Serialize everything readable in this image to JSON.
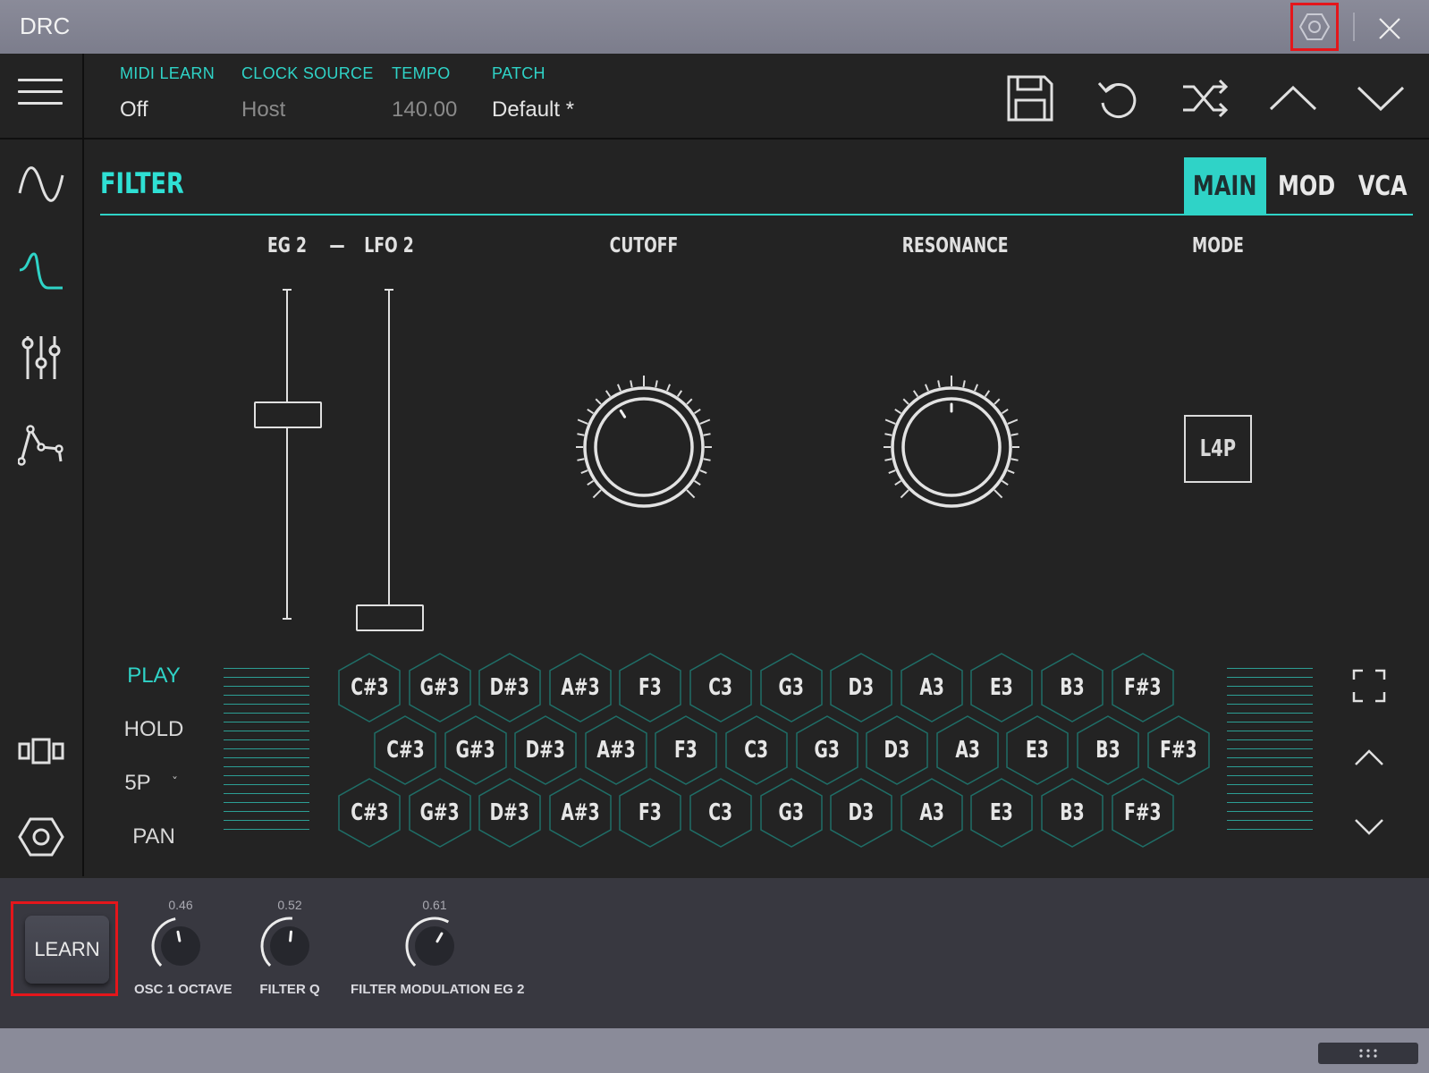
{
  "window": {
    "title": "DRC"
  },
  "header": {
    "midi_learn": {
      "label": "MIDI LEARN",
      "value": "Off"
    },
    "clock_source": {
      "label": "CLOCK SOURCE",
      "value": "Host"
    },
    "tempo": {
      "label": "TEMPO",
      "value": "140.00"
    },
    "patch": {
      "label": "PATCH",
      "value": "Default *"
    }
  },
  "filter": {
    "title": "FILTER",
    "tabs": [
      {
        "label": "MAIN",
        "active": true
      },
      {
        "label": "MOD",
        "active": false
      },
      {
        "label": "VCA",
        "active": false
      }
    ],
    "eg2_label": "EG 2",
    "dash": "—",
    "lfo2_label": "LFO 2",
    "eg2_level": 0.62,
    "lfo2_level": 0.0,
    "cutoff_label": "CUTOFF",
    "cutoff_level": 0.38,
    "resonance_label": "RESONANCE",
    "resonance_level": 0.5,
    "mode_label": "MODE",
    "mode_value": "L4P"
  },
  "keyboard": {
    "modes": [
      "PLAY",
      "HOLD",
      "5P",
      "PAN"
    ],
    "active_mode": "PLAY",
    "dropdown_glyph": "ˇ",
    "rows": [
      [
        "C#3",
        "G#3",
        "D#3",
        "A#3",
        "F3",
        "C3",
        "G3",
        "D3",
        "A3",
        "E3",
        "B3",
        "F#3"
      ],
      [
        "C#3",
        "G#3",
        "D#3",
        "A#3",
        "F3",
        "C3",
        "G3",
        "D3",
        "A3",
        "E3",
        "B3",
        "F#3"
      ],
      [
        "C#3",
        "G#3",
        "D#3",
        "A#3",
        "F3",
        "C3",
        "G3",
        "D3",
        "A3",
        "E3",
        "B3",
        "F#3"
      ]
    ]
  },
  "learn_bar": {
    "learn_label": "LEARN",
    "assignments": [
      {
        "name": "OSC 1 OCTAVE",
        "value": "0.46"
      },
      {
        "name": "FILTER Q",
        "value": "0.52"
      },
      {
        "name": "FILTER MODULATION EG 2",
        "value": "0.61"
      }
    ]
  },
  "icons": {
    "accent": "#2fd3c7",
    "highlight": "#e4161b",
    "sidebar": [
      "oscillator-icon",
      "filter-icon",
      "mixer-icon",
      "envelope-icon",
      "layout-icon",
      "settings-icon"
    ],
    "header_actions": [
      "save-icon",
      "undo-icon",
      "randomize-icon",
      "previous-patch-icon",
      "next-patch-icon"
    ]
  }
}
